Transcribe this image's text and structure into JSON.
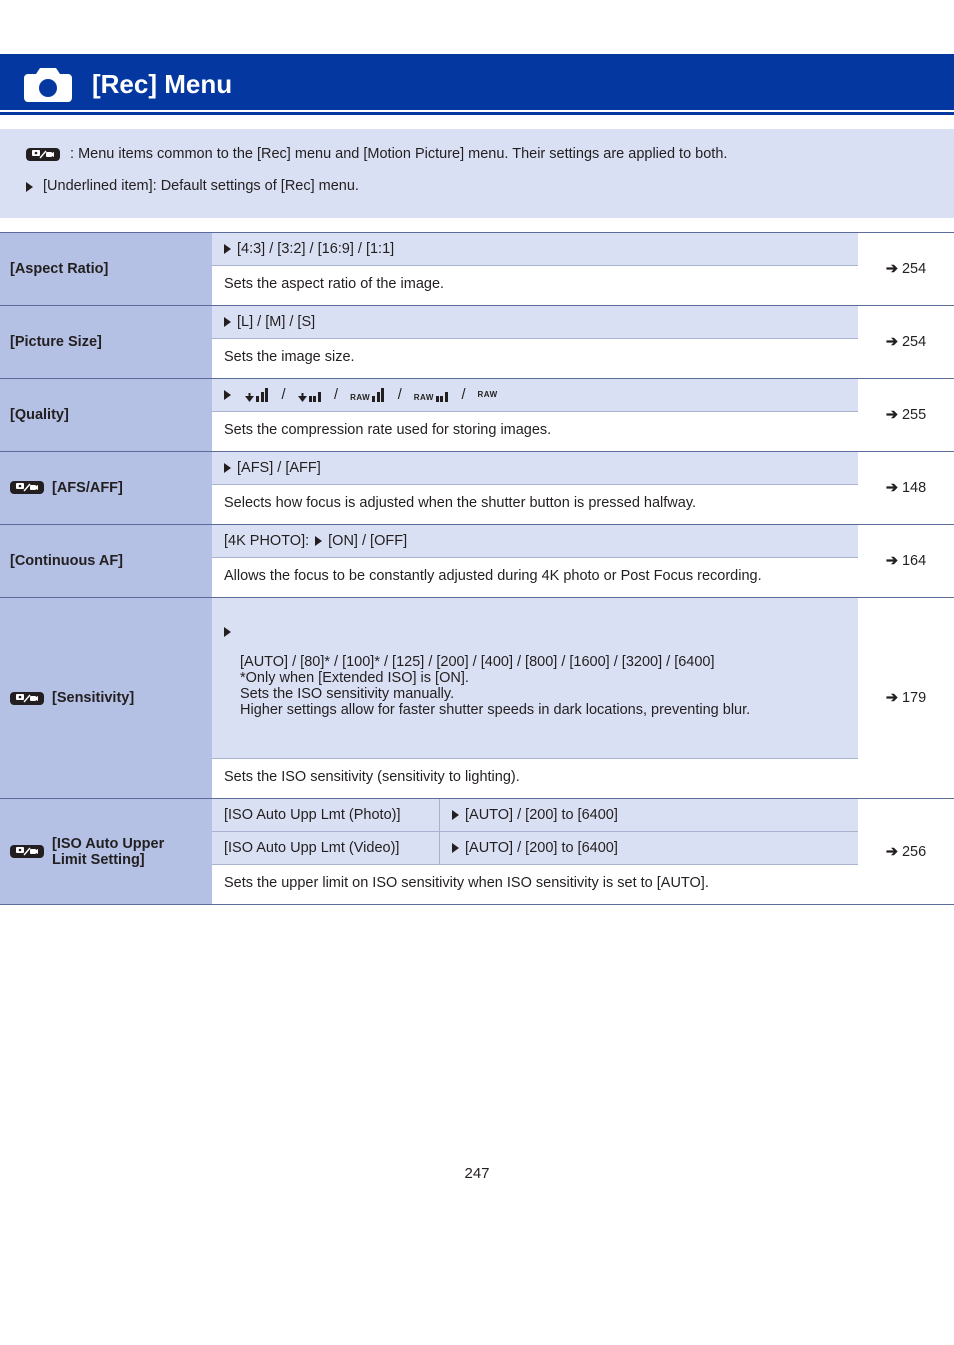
{
  "title": "[Rec] Menu",
  "intro": {
    "line1_prefix": ": Menu items common to the [Rec] menu and [Motion Picture] menu. Their settings are applied to both.",
    "line2": "[Underlined item]: Default settings of [Rec] menu."
  },
  "rows": [
    {
      "name": "[Aspect Ratio]",
      "badge": false,
      "options": "[4:3] / [3:2] / [16:9] / [1:1]",
      "desc": "Sets the aspect ratio of the image.",
      "ref": "254"
    },
    {
      "name": "[Picture Size]",
      "badge": false,
      "options": "[L] / [M] / [S]",
      "desc": "Sets the image size.",
      "ref": "254"
    },
    {
      "name": "[Quality]",
      "badge": false,
      "options_raw": true,
      "desc": "Sets the compression rate used for storing images.",
      "ref": "255"
    },
    {
      "name": "[AFS/AFF]",
      "badge": true,
      "options": "[AFS] / [AFF]",
      "desc": "Selects how focus is adjusted when the shutter button is pressed halfway.",
      "ref": "148"
    },
    {
      "name": "[Continuous AF]",
      "badge": false,
      "options_prefix": "[4K PHOTO]:  ",
      "options": "[ON] / [OFF]",
      "desc": "Allows the focus to be constantly adjusted during 4K photo or Post Focus recording.",
      "ref": "164"
    },
    {
      "name": "[Sensitivity]",
      "badge": true,
      "options_block": "[AUTO] / [80]* / [100]* / [125] / [200] / [400] / [800] / [1600] / [3200] / [6400]\n*Only when [Extended ISO] is [ON].\nSets the ISO sensitivity manually.\nHigher settings allow for faster shutter speeds in dark locations, preventing blur.",
      "desc": "Sets the ISO sensitivity (sensitivity to lighting).",
      "ref": "179"
    },
    {
      "name": "[ISO Auto Upper Limit Setting]",
      "badge": true,
      "sub": [
        {
          "k": "[ISO Auto Upp Lmt (Photo)]",
          "v": "[AUTO] / [200] to [6400]"
        },
        {
          "k": "[ISO Auto Upp Lmt (Video)]",
          "v": "[AUTO] / [200] to [6400]"
        }
      ],
      "desc": "Sets the upper limit on ISO sensitivity when ISO sensitivity is set to [AUTO].",
      "ref": "256"
    }
  ],
  "page_no": "247"
}
